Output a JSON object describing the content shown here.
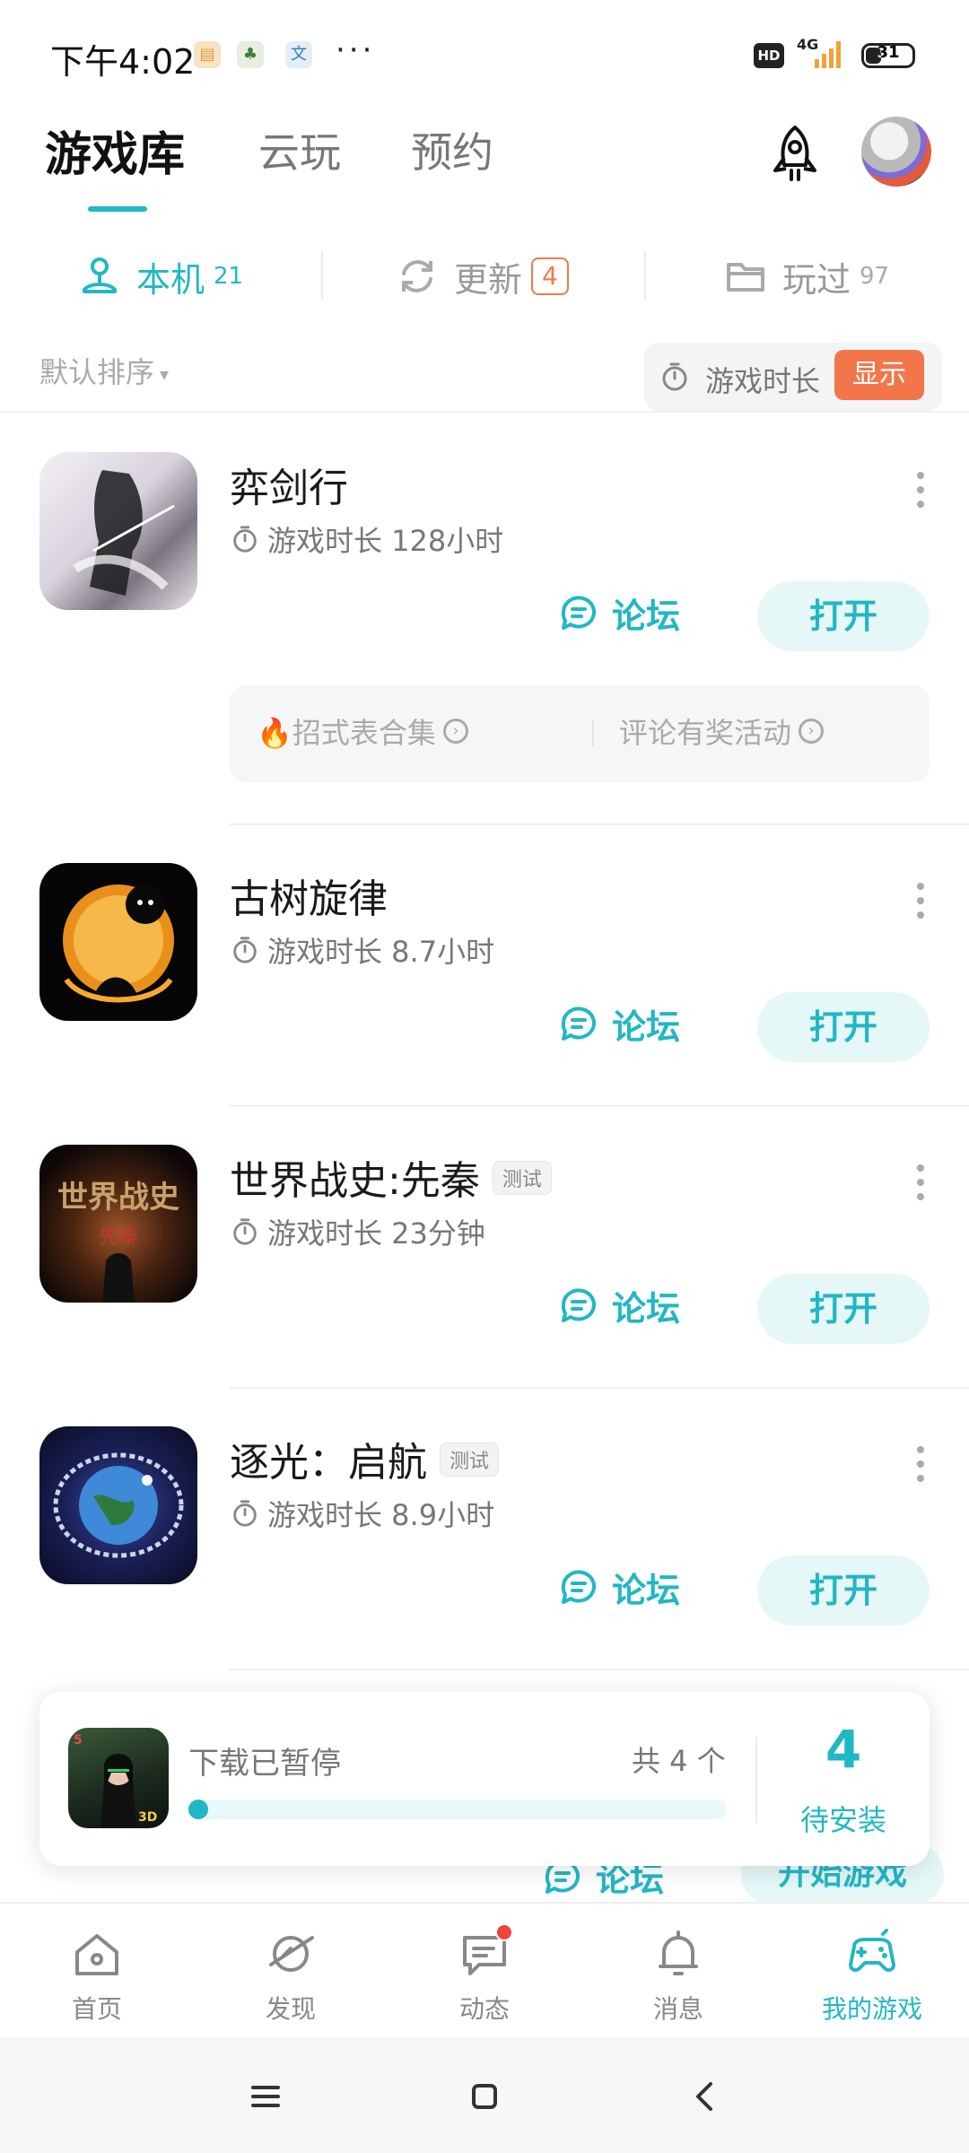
{
  "status_bar": {
    "time": "下午4:02",
    "network": "4G",
    "hd": "HD",
    "battery": "31",
    "battery_fraction": 0.31,
    "overflow": "···"
  },
  "top_tabs": {
    "items": [
      {
        "label": "游戏库",
        "active": true
      },
      {
        "label": "云玩",
        "active": false
      },
      {
        "label": "预约",
        "active": false
      }
    ]
  },
  "sub_tabs": {
    "local": {
      "label": "本机",
      "count": "21"
    },
    "updates": {
      "label": "更新",
      "count": "4"
    },
    "played": {
      "label": "玩过",
      "count": "97"
    }
  },
  "sort": {
    "label": "默认排序",
    "duration_label": "游戏时长",
    "show_label": "显示"
  },
  "games": [
    {
      "name": "弈剑行",
      "time": "游戏时长 128小时",
      "tag": "",
      "forum": "论坛",
      "open": "打开",
      "activities": [
        "🔥招式表合集",
        "评论有奖活动"
      ]
    },
    {
      "name": "古树旋律",
      "time": "游戏时长 8.7小时",
      "tag": "",
      "forum": "论坛",
      "open": "打开"
    },
    {
      "name": "世界战史:先秦",
      "time": "游戏时长 23分钟",
      "tag": "测试",
      "forum": "论坛",
      "open": "打开"
    },
    {
      "name": "逐光：启航",
      "time": "游戏时长 8.9小时",
      "tag": "测试",
      "forum": "论坛",
      "open": "打开"
    }
  ],
  "peek_item": {
    "forum": "论坛",
    "start": "开始游戏"
  },
  "download": {
    "status": "下载已暂停",
    "total": "共 4 个",
    "pending_count": "4",
    "pending_label": "待安装"
  },
  "bottom_nav": [
    {
      "label": "首页",
      "icon": "home-icon"
    },
    {
      "label": "发现",
      "icon": "discover-icon"
    },
    {
      "label": "动态",
      "icon": "feed-icon"
    },
    {
      "label": "消息",
      "icon": "bell-icon"
    },
    {
      "label": "我的游戏",
      "icon": "gamepad-icon"
    }
  ],
  "colors": {
    "accent": "#22b7c5",
    "orange": "#f3764b",
    "red_dot": "#f0443b"
  }
}
